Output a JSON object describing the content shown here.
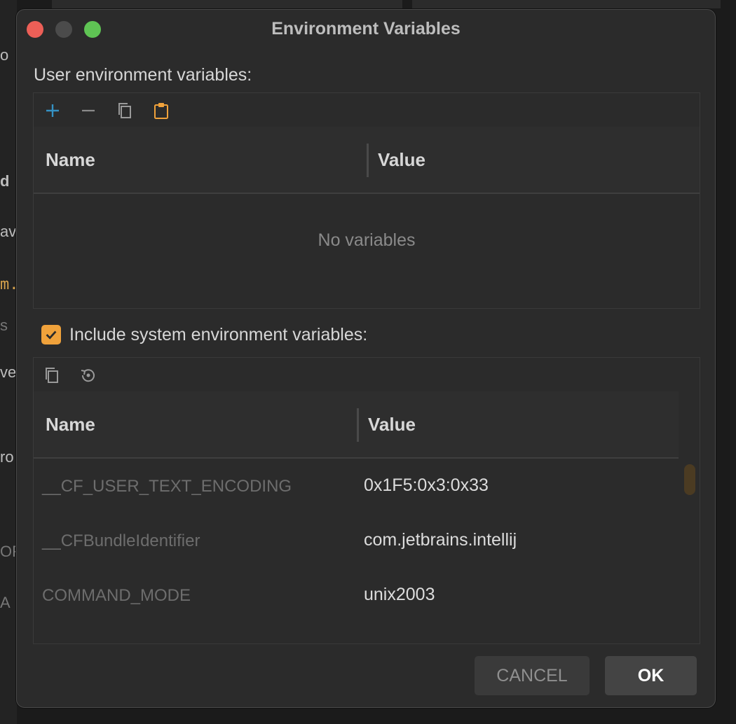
{
  "dialog": {
    "title": "Environment Variables",
    "user_section_label": "User environment variables:",
    "user_toolbar": {
      "add_icon": "plus-icon",
      "remove_icon": "minus-icon",
      "copy_icon": "copy-icon",
      "paste_icon": "clipboard-icon"
    },
    "user_table": {
      "col_name": "Name",
      "col_value": "Value",
      "empty_text": "No variables"
    },
    "include_system": {
      "checked": true,
      "label": "Include system environment variables:"
    },
    "system_toolbar": {
      "copy_icon": "copy-icon",
      "reset_icon": "reset-icon"
    },
    "system_table": {
      "col_name": "Name",
      "col_value": "Value",
      "rows": [
        {
          "name": "__CF_USER_TEXT_ENCODING",
          "value": "0x1F5:0x3:0x33"
        },
        {
          "name": "__CFBundleIdentifier",
          "value": "com.jetbrains.intellij"
        },
        {
          "name": "COMMAND_MODE",
          "value": "unix2003"
        }
      ]
    },
    "buttons": {
      "cancel": "CANCEL",
      "ok": "OK"
    }
  },
  "background": {
    "fragments": [
      "o",
      "d",
      "av",
      "m.",
      "s",
      "ve",
      "ro",
      "OF",
      "A"
    ]
  },
  "colors": {
    "accent": "#f0a23b",
    "add_icon": "#3592c4",
    "paste_icon": "#f0a23b"
  }
}
